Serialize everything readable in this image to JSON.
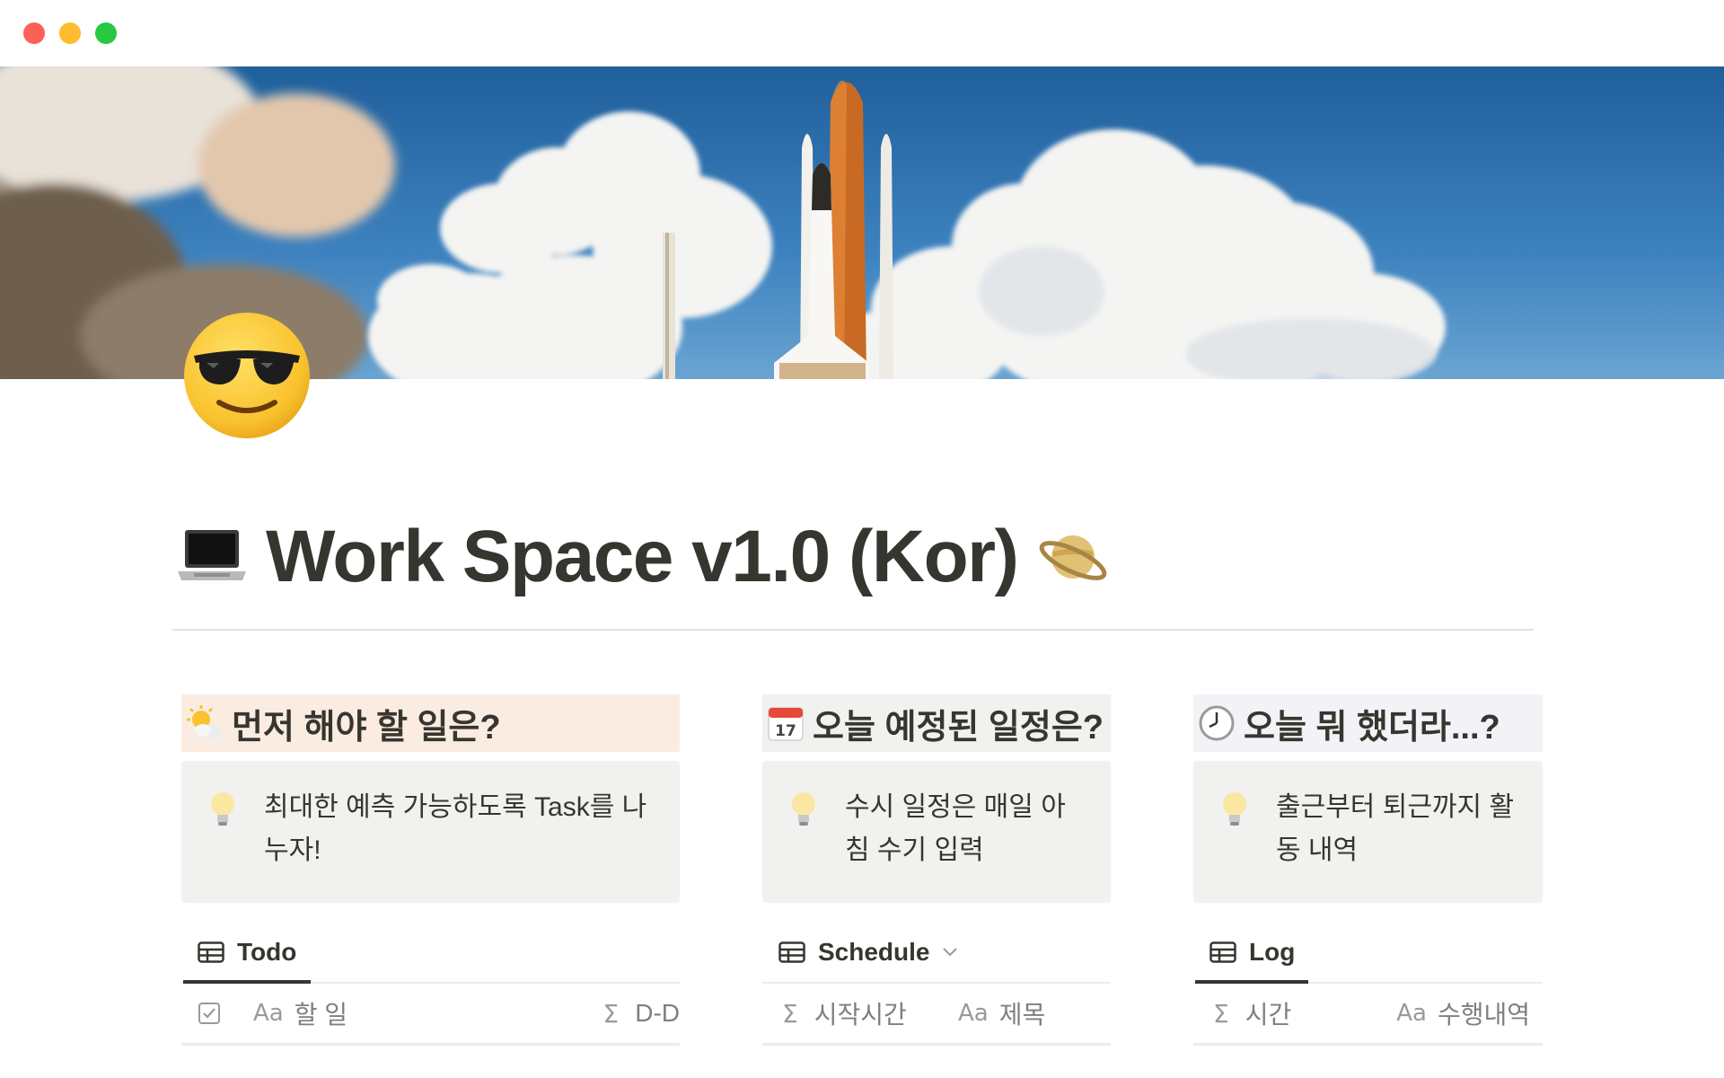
{
  "window": {
    "traffic_lights": [
      "close",
      "minimize",
      "maximize"
    ],
    "colors": {
      "close": "#fe5f57",
      "minimize": "#febc2e",
      "maximize": "#28c840"
    }
  },
  "page": {
    "icon": "sunglasses-face-emoji",
    "title_prefix_icon": "laptop-emoji",
    "title": "Work Space v1.0 (Kor)",
    "title_suffix_icon": "ringed-planet-emoji",
    "cover": "space-shuttle-launch-photo"
  },
  "columns": [
    {
      "heading_icon": "sun-behind-cloud-emoji",
      "heading": "먼저 해야 할 일은?",
      "heading_bg": "#fbece1",
      "callout_icon": "lightbulb-emoji",
      "callout": "최대한 예측 가능하도록 Task를 나누자!",
      "view_icon": "table-icon",
      "view_label": "Todo",
      "properties": [
        {
          "icon": "checkbox-property-icon",
          "label": ""
        },
        {
          "icon": "title-property-icon",
          "prefix": "Aa",
          "label": "할 일"
        },
        {
          "icon": "formula-property-icon",
          "prefix": "Σ",
          "label": "D-D"
        }
      ]
    },
    {
      "heading_icon": "calendar-emoji",
      "heading": "오늘 예정된 일정은?",
      "heading_bg": "#f1f1ef",
      "callout_icon": "lightbulb-emoji",
      "callout": "수시 일정은 매일 아침 수기 입력",
      "view_icon": "table-icon",
      "view_label": "Schedule",
      "view_chevron": "chevron-down-icon",
      "properties": [
        {
          "icon": "formula-property-icon",
          "prefix": "Σ",
          "label": "시작시간"
        },
        {
          "icon": "title-property-icon",
          "prefix": "Aa",
          "label": "제목"
        }
      ]
    },
    {
      "heading_icon": "clock-emoji",
      "heading": "오늘 뭐 했더라...?",
      "heading_bg": "#f3f2f7",
      "callout_icon": "lightbulb-emoji",
      "callout": "출근부터 퇴근까지 활동 내역",
      "view_icon": "table-icon",
      "view_label": "Log",
      "properties": [
        {
          "icon": "formula-property-icon",
          "prefix": "Σ",
          "label": "시간"
        },
        {
          "icon": "title-property-icon",
          "prefix": "Aa",
          "label": "수행내역"
        }
      ]
    }
  ]
}
